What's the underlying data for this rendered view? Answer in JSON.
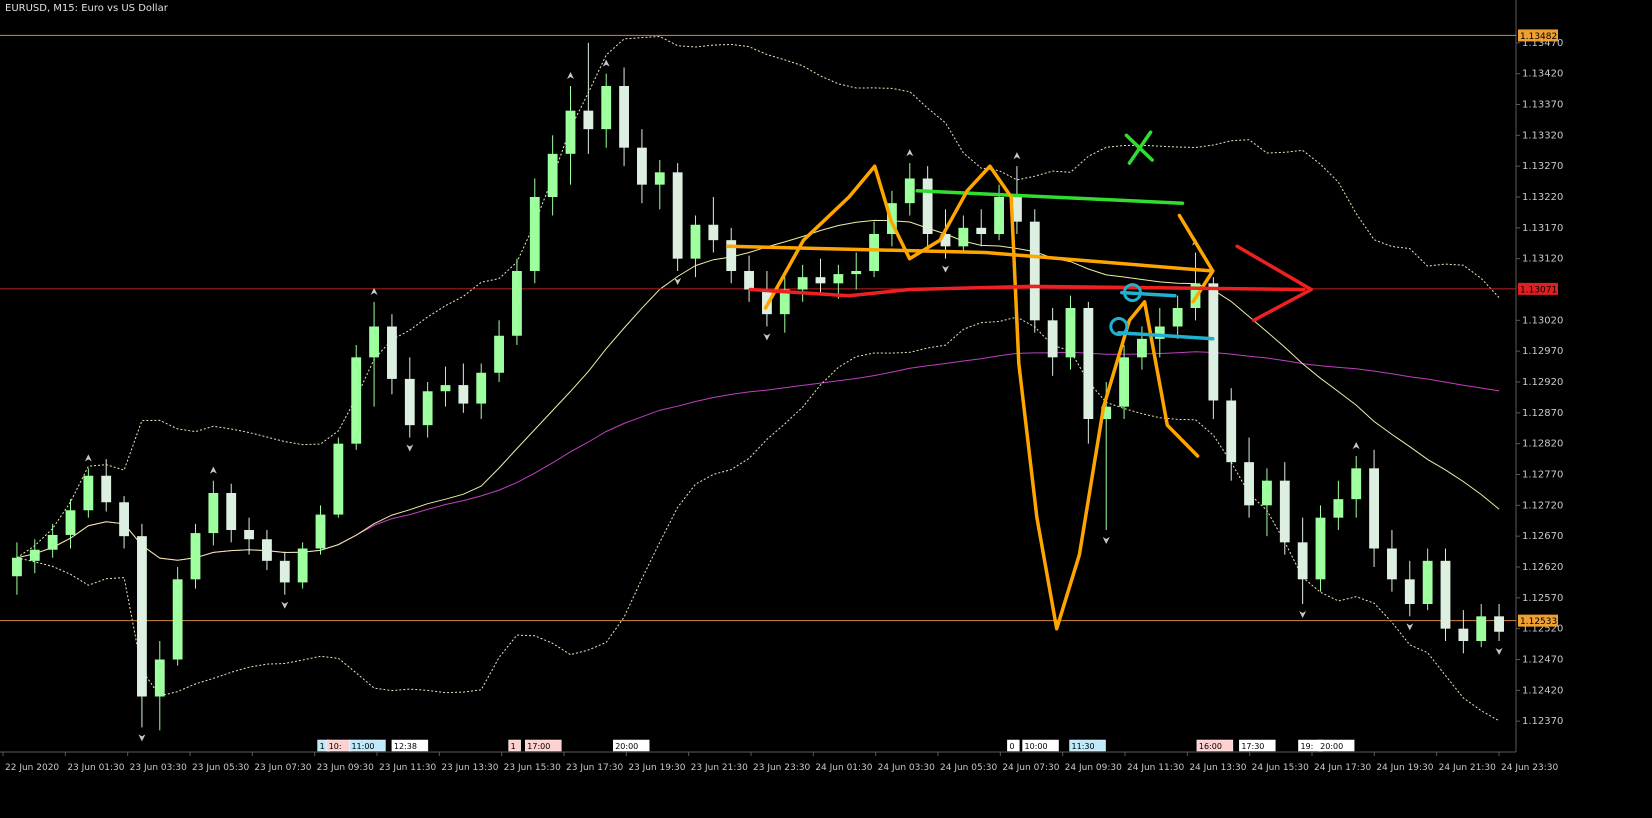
{
  "window": {
    "title": "EURUSD, M15:  Euro vs US Dollar"
  },
  "colors": {
    "background": "#000000",
    "grid": "#5a5a5a",
    "axis_text": "#c8c8c8",
    "bull": "#9eff9e",
    "bear": "#dcefe0",
    "fractal": "#c8c8c8",
    "bands": "#e8e8c0",
    "ma_fast": "#eeeea8",
    "ma_slow": "#c040c0",
    "level_top": "#d08840",
    "level_bottom": "#d08840",
    "level_red": "#c02020",
    "label_orange": "#f0a030",
    "label_red": "#e02020",
    "draw_green": "#30dd30",
    "draw_orange": "#ffa500",
    "draw_red": "#ee2020",
    "draw_blue": "#20b0d0"
  },
  "chart_data": {
    "type": "candlestick",
    "symbol": "EURUSD",
    "timeframe": "M15",
    "ylim": [
      1.1232,
      1.1352
    ],
    "y_ticks": [
      "1.13470",
      "1.13420",
      "1.13370",
      "1.13320",
      "1.13270",
      "1.13220",
      "1.13170",
      "1.13120",
      "1.13020",
      "1.12970",
      "1.12920",
      "1.12870",
      "1.12820",
      "1.12770",
      "1.12720",
      "1.12670",
      "1.12620",
      "1.12570",
      "1.12520",
      "1.12470",
      "1.12420",
      "1.12370"
    ],
    "x_labels": [
      "22 Jun 2020",
      "23 Jun 01:30",
      "23 Jun 03:30",
      "23 Jun 05:30",
      "23 Jun 07:30",
      "23 Jun 09:30",
      "23 Jun 11:30",
      "23 Jun 13:30",
      "23 Jun 15:30",
      "23 Jun 17:30",
      "23 Jun 19:30",
      "23 Jun 21:30",
      "23 Jun 23:30",
      "24 Jun 01:30",
      "24 Jun 03:30",
      "24 Jun 05:30",
      "24 Jun 07:30",
      "24 Jun 09:30",
      "24 Jun 11:30",
      "24 Jun 13:30",
      "24 Jun 15:30",
      "24 Jun 17:30",
      "24 Jun 19:30",
      "24 Jun 21:30",
      "24 Jun 23:30"
    ],
    "levels": [
      {
        "price": 1.13482,
        "label": "1.13482",
        "style": "top"
      },
      {
        "price": 1.13071,
        "label": "1.13071",
        "style": "red"
      },
      {
        "price": 1.12533,
        "label": "1.12533",
        "style": "bottom"
      }
    ],
    "event_tags": [
      {
        "text": "1",
        "fill": "#bfe8f8",
        "edge": "#ffffff",
        "at": 0.2095
      },
      {
        "text": "10:",
        "fill": "#ffd0d0",
        "edge": "#ffffff",
        "at": 0.2155
      },
      {
        "text": "11:00",
        "fill": "#bfe8f8",
        "edge": "#ffffff",
        "at": 0.2305
      },
      {
        "text": "12:38",
        "fill": "#ffffff",
        "edge": "#ffffff",
        "at": 0.2585
      },
      {
        "text": "1",
        "fill": "#ffd0d0",
        "edge": "#ffffff",
        "at": 0.3355
      },
      {
        "text": "17:00",
        "fill": "#ffd0d0",
        "edge": "#ffffff",
        "at": 0.3465
      },
      {
        "text": "20:00",
        "fill": "#ffffff",
        "edge": "#ffffff",
        "at": 0.4045
      },
      {
        "text": "0",
        "fill": "#ffffff",
        "edge": "#ffffff",
        "at": 0.6645
      },
      {
        "text": "10:00",
        "fill": "#ffffff",
        "edge": "#ffffff",
        "at": 0.6745
      },
      {
        "text": "11:30",
        "fill": "#bfe8f8",
        "edge": "#ffffff",
        "at": 0.7055
      },
      {
        "text": "16:00",
        "fill": "#ffd0d0",
        "edge": "#ffffff",
        "at": 0.7895
      },
      {
        "text": "17:30",
        "fill": "#ffffff",
        "edge": "#ffffff",
        "at": 0.8175
      },
      {
        "text": "19:",
        "fill": "#ffffff",
        "edge": "#ffffff",
        "at": 0.8565
      },
      {
        "text": "20:00",
        "fill": "#ffffff",
        "edge": "#ffffff",
        "at": 0.8695
      }
    ],
    "candles": [
      {
        "o": 1.12605,
        "h": 1.1266,
        "l": 1.12575,
        "c": 1.12635
      },
      {
        "o": 1.1263,
        "h": 1.12665,
        "l": 1.1261,
        "c": 1.12648
      },
      {
        "o": 1.12648,
        "h": 1.1269,
        "l": 1.12635,
        "c": 1.12672
      },
      {
        "o": 1.12672,
        "h": 1.1273,
        "l": 1.1265,
        "c": 1.12712
      },
      {
        "o": 1.12712,
        "h": 1.1278,
        "l": 1.127,
        "c": 1.12768
      },
      {
        "o": 1.12768,
        "h": 1.12795,
        "l": 1.1271,
        "c": 1.12725
      },
      {
        "o": 1.12725,
        "h": 1.12735,
        "l": 1.1265,
        "c": 1.1267
      },
      {
        "o": 1.1267,
        "h": 1.1269,
        "l": 1.1236,
        "c": 1.1241
      },
      {
        "o": 1.1241,
        "h": 1.125,
        "l": 1.12355,
        "c": 1.1247
      },
      {
        "o": 1.1247,
        "h": 1.1262,
        "l": 1.1246,
        "c": 1.126
      },
      {
        "o": 1.126,
        "h": 1.1269,
        "l": 1.12585,
        "c": 1.12675
      },
      {
        "o": 1.12675,
        "h": 1.1276,
        "l": 1.12655,
        "c": 1.1274
      },
      {
        "o": 1.1274,
        "h": 1.12755,
        "l": 1.1266,
        "c": 1.1268
      },
      {
        "o": 1.1268,
        "h": 1.127,
        "l": 1.1264,
        "c": 1.12665
      },
      {
        "o": 1.12665,
        "h": 1.1268,
        "l": 1.12615,
        "c": 1.1263
      },
      {
        "o": 1.1263,
        "h": 1.12645,
        "l": 1.12575,
        "c": 1.12595
      },
      {
        "o": 1.12595,
        "h": 1.1266,
        "l": 1.12585,
        "c": 1.1265
      },
      {
        "o": 1.1265,
        "h": 1.1272,
        "l": 1.1264,
        "c": 1.12705
      },
      {
        "o": 1.12705,
        "h": 1.1283,
        "l": 1.127,
        "c": 1.1282
      },
      {
        "o": 1.1282,
        "h": 1.1298,
        "l": 1.1281,
        "c": 1.1296
      },
      {
        "o": 1.1296,
        "h": 1.1305,
        "l": 1.1288,
        "c": 1.1301
      },
      {
        "o": 1.1301,
        "h": 1.1303,
        "l": 1.129,
        "c": 1.12925
      },
      {
        "o": 1.12925,
        "h": 1.1296,
        "l": 1.1283,
        "c": 1.1285
      },
      {
        "o": 1.1285,
        "h": 1.1292,
        "l": 1.1283,
        "c": 1.12905
      },
      {
        "o": 1.12905,
        "h": 1.12945,
        "l": 1.1288,
        "c": 1.12915
      },
      {
        "o": 1.12915,
        "h": 1.1295,
        "l": 1.1287,
        "c": 1.12885
      },
      {
        "o": 1.12885,
        "h": 1.1295,
        "l": 1.1286,
        "c": 1.12935
      },
      {
        "o": 1.12935,
        "h": 1.1302,
        "l": 1.1292,
        "c": 1.12995
      },
      {
        "o": 1.12995,
        "h": 1.1312,
        "l": 1.1298,
        "c": 1.131
      },
      {
        "o": 1.131,
        "h": 1.1325,
        "l": 1.1308,
        "c": 1.1322
      },
      {
        "o": 1.1322,
        "h": 1.1332,
        "l": 1.1319,
        "c": 1.1329
      },
      {
        "o": 1.1329,
        "h": 1.134,
        "l": 1.1324,
        "c": 1.1336
      },
      {
        "o": 1.1336,
        "h": 1.1347,
        "l": 1.1329,
        "c": 1.1333
      },
      {
        "o": 1.1333,
        "h": 1.1342,
        "l": 1.133,
        "c": 1.134
      },
      {
        "o": 1.134,
        "h": 1.1343,
        "l": 1.1327,
        "c": 1.133
      },
      {
        "o": 1.133,
        "h": 1.1333,
        "l": 1.1321,
        "c": 1.1324
      },
      {
        "o": 1.1324,
        "h": 1.1328,
        "l": 1.132,
        "c": 1.1326
      },
      {
        "o": 1.1326,
        "h": 1.13275,
        "l": 1.131,
        "c": 1.1312
      },
      {
        "o": 1.1312,
        "h": 1.1319,
        "l": 1.1309,
        "c": 1.13175
      },
      {
        "o": 1.13175,
        "h": 1.1322,
        "l": 1.1313,
        "c": 1.1315
      },
      {
        "o": 1.1315,
        "h": 1.1317,
        "l": 1.1308,
        "c": 1.131
      },
      {
        "o": 1.131,
        "h": 1.13125,
        "l": 1.1305,
        "c": 1.1307
      },
      {
        "o": 1.1307,
        "h": 1.131,
        "l": 1.1301,
        "c": 1.1303
      },
      {
        "o": 1.1303,
        "h": 1.1309,
        "l": 1.13,
        "c": 1.1307
      },
      {
        "o": 1.1307,
        "h": 1.1311,
        "l": 1.1305,
        "c": 1.1309
      },
      {
        "o": 1.1309,
        "h": 1.1312,
        "l": 1.1306,
        "c": 1.1308
      },
      {
        "o": 1.1308,
        "h": 1.1311,
        "l": 1.13055,
        "c": 1.13095
      },
      {
        "o": 1.13095,
        "h": 1.1313,
        "l": 1.1307,
        "c": 1.131
      },
      {
        "o": 1.131,
        "h": 1.1318,
        "l": 1.1309,
        "c": 1.1316
      },
      {
        "o": 1.1316,
        "h": 1.1323,
        "l": 1.1314,
        "c": 1.1321
      },
      {
        "o": 1.1321,
        "h": 1.13275,
        "l": 1.1319,
        "c": 1.1325
      },
      {
        "o": 1.1325,
        "h": 1.1327,
        "l": 1.1314,
        "c": 1.1316
      },
      {
        "o": 1.1316,
        "h": 1.132,
        "l": 1.1312,
        "c": 1.1314
      },
      {
        "o": 1.1314,
        "h": 1.1319,
        "l": 1.1313,
        "c": 1.1317
      },
      {
        "o": 1.1317,
        "h": 1.132,
        "l": 1.1314,
        "c": 1.1316
      },
      {
        "o": 1.1316,
        "h": 1.1324,
        "l": 1.1315,
        "c": 1.1322
      },
      {
        "o": 1.1322,
        "h": 1.1327,
        "l": 1.1316,
        "c": 1.1318
      },
      {
        "o": 1.1318,
        "h": 1.132,
        "l": 1.13,
        "c": 1.1302
      },
      {
        "o": 1.1302,
        "h": 1.1304,
        "l": 1.1293,
        "c": 1.1296
      },
      {
        "o": 1.1296,
        "h": 1.1306,
        "l": 1.1294,
        "c": 1.1304
      },
      {
        "o": 1.1304,
        "h": 1.1305,
        "l": 1.1282,
        "c": 1.1286
      },
      {
        "o": 1.1286,
        "h": 1.1292,
        "l": 1.1268,
        "c": 1.1288
      },
      {
        "o": 1.1288,
        "h": 1.1298,
        "l": 1.1286,
        "c": 1.1296
      },
      {
        "o": 1.1296,
        "h": 1.1301,
        "l": 1.1294,
        "c": 1.1299
      },
      {
        "o": 1.1299,
        "h": 1.1304,
        "l": 1.1296,
        "c": 1.1301
      },
      {
        "o": 1.1301,
        "h": 1.1306,
        "l": 1.1299,
        "c": 1.1304
      },
      {
        "o": 1.1304,
        "h": 1.1313,
        "l": 1.1302,
        "c": 1.1308
      },
      {
        "o": 1.1308,
        "h": 1.1309,
        "l": 1.1286,
        "c": 1.1289
      },
      {
        "o": 1.1289,
        "h": 1.1291,
        "l": 1.1276,
        "c": 1.1279
      },
      {
        "o": 1.1279,
        "h": 1.1283,
        "l": 1.127,
        "c": 1.1272
      },
      {
        "o": 1.1272,
        "h": 1.1278,
        "l": 1.1267,
        "c": 1.1276
      },
      {
        "o": 1.1276,
        "h": 1.1279,
        "l": 1.1264,
        "c": 1.1266
      },
      {
        "o": 1.1266,
        "h": 1.127,
        "l": 1.1256,
        "c": 1.126
      },
      {
        "o": 1.126,
        "h": 1.1272,
        "l": 1.1258,
        "c": 1.127
      },
      {
        "o": 1.127,
        "h": 1.1276,
        "l": 1.1268,
        "c": 1.1273
      },
      {
        "o": 1.1273,
        "h": 1.128,
        "l": 1.127,
        "c": 1.1278
      },
      {
        "o": 1.1278,
        "h": 1.1281,
        "l": 1.1262,
        "c": 1.1265
      },
      {
        "o": 1.1265,
        "h": 1.1268,
        "l": 1.1258,
        "c": 1.126
      },
      {
        "o": 1.126,
        "h": 1.1263,
        "l": 1.1254,
        "c": 1.1256
      },
      {
        "o": 1.1256,
        "h": 1.1265,
        "l": 1.1255,
        "c": 1.1263
      },
      {
        "o": 1.1263,
        "h": 1.1265,
        "l": 1.125,
        "c": 1.1252
      },
      {
        "o": 1.1252,
        "h": 1.1255,
        "l": 1.1248,
        "c": 1.125
      },
      {
        "o": 1.125,
        "h": 1.1256,
        "l": 1.1249,
        "c": 1.1254
      },
      {
        "o": 1.1254,
        "h": 1.1256,
        "l": 1.125,
        "c": 1.12515
      }
    ],
    "fractals": [
      {
        "i": 4,
        "up": true
      },
      {
        "i": 7,
        "up": false
      },
      {
        "i": 11,
        "up": true
      },
      {
        "i": 15,
        "up": false
      },
      {
        "i": 20,
        "up": true
      },
      {
        "i": 22,
        "up": false
      },
      {
        "i": 31,
        "up": true
      },
      {
        "i": 33,
        "up": true
      },
      {
        "i": 37,
        "up": false
      },
      {
        "i": 42,
        "up": false
      },
      {
        "i": 50,
        "up": true
      },
      {
        "i": 52,
        "up": false
      },
      {
        "i": 56,
        "up": true
      },
      {
        "i": 61,
        "up": false
      },
      {
        "i": 66,
        "up": true
      },
      {
        "i": 72,
        "up": false
      },
      {
        "i": 75,
        "up": true
      },
      {
        "i": 78,
        "up": false
      },
      {
        "i": 83,
        "up": false
      }
    ],
    "indicators": {
      "ma_fast_period": 20,
      "ma_slow_period": 100,
      "bands_period": 20,
      "bands_deviation": 2
    },
    "drawings": [
      {
        "name": "green-line",
        "color": "#30dd30",
        "pts": [
          [
            0.605,
            1.1323
          ],
          [
            0.78,
            1.1321
          ]
        ]
      },
      {
        "name": "green-x-1",
        "color": "#30dd30",
        "pts": [
          [
            0.743,
            1.1332
          ],
          [
            0.76,
            1.1328
          ]
        ]
      },
      {
        "name": "green-x-2",
        "color": "#30dd30",
        "pts": [
          [
            0.745,
            1.13275
          ],
          [
            0.759,
            1.13325
          ]
        ]
      },
      {
        "name": "orange-arrow-line",
        "color": "#ffa500",
        "pts": [
          [
            0.48,
            1.1314
          ],
          [
            0.65,
            1.1313
          ],
          [
            0.8,
            1.131
          ]
        ]
      },
      {
        "name": "orange-arrow-head-1",
        "color": "#ffa500",
        "pts": [
          [
            0.778,
            1.1319
          ],
          [
            0.8,
            1.131
          ],
          [
            0.787,
            1.1305
          ]
        ]
      },
      {
        "name": "orange-wave",
        "color": "#ffa500",
        "pts": [
          [
            0.505,
            1.1304
          ],
          [
            0.53,
            1.1315
          ],
          [
            0.56,
            1.1322
          ],
          [
            0.577,
            1.1327
          ],
          [
            0.588,
            1.1318
          ],
          [
            0.6,
            1.1312
          ],
          [
            0.62,
            1.1315
          ],
          [
            0.638,
            1.1323
          ],
          [
            0.653,
            1.1327
          ],
          [
            0.667,
            1.1322
          ],
          [
            0.672,
            1.1295
          ],
          [
            0.684,
            1.127
          ],
          [
            0.697,
            1.1252
          ],
          [
            0.712,
            1.1264
          ],
          [
            0.728,
            1.1288
          ],
          [
            0.745,
            1.1302
          ],
          [
            0.755,
            1.1305
          ],
          [
            0.77,
            1.1285
          ],
          [
            0.79,
            1.128
          ]
        ]
      },
      {
        "name": "red-line",
        "color": "#ee2020",
        "pts": [
          [
            0.495,
            1.1307
          ],
          [
            0.56,
            1.1306
          ],
          [
            0.6,
            1.1307
          ],
          [
            0.68,
            1.13075
          ],
          [
            0.86,
            1.1307
          ]
        ]
      },
      {
        "name": "red-arrow-head",
        "color": "#ee2020",
        "pts": [
          [
            0.816,
            1.1314
          ],
          [
            0.865,
            1.1307
          ],
          [
            0.827,
            1.1302
          ]
        ]
      },
      {
        "name": "blue-line-1",
        "color": "#20b0d0",
        "pts": [
          [
            0.74,
            1.13065
          ],
          [
            0.775,
            1.1306
          ]
        ]
      },
      {
        "name": "blue-line-2",
        "color": "#20b0d0",
        "pts": [
          [
            0.738,
            1.13
          ],
          [
            0.8,
            1.1299
          ]
        ]
      }
    ],
    "markers": [
      {
        "name": "blue-circle-1",
        "color": "#20b0d0",
        "x": 0.747,
        "y": 1.13065
      },
      {
        "name": "blue-circle-2",
        "color": "#20b0d0",
        "x": 0.738,
        "y": 1.1301
      }
    ]
  }
}
